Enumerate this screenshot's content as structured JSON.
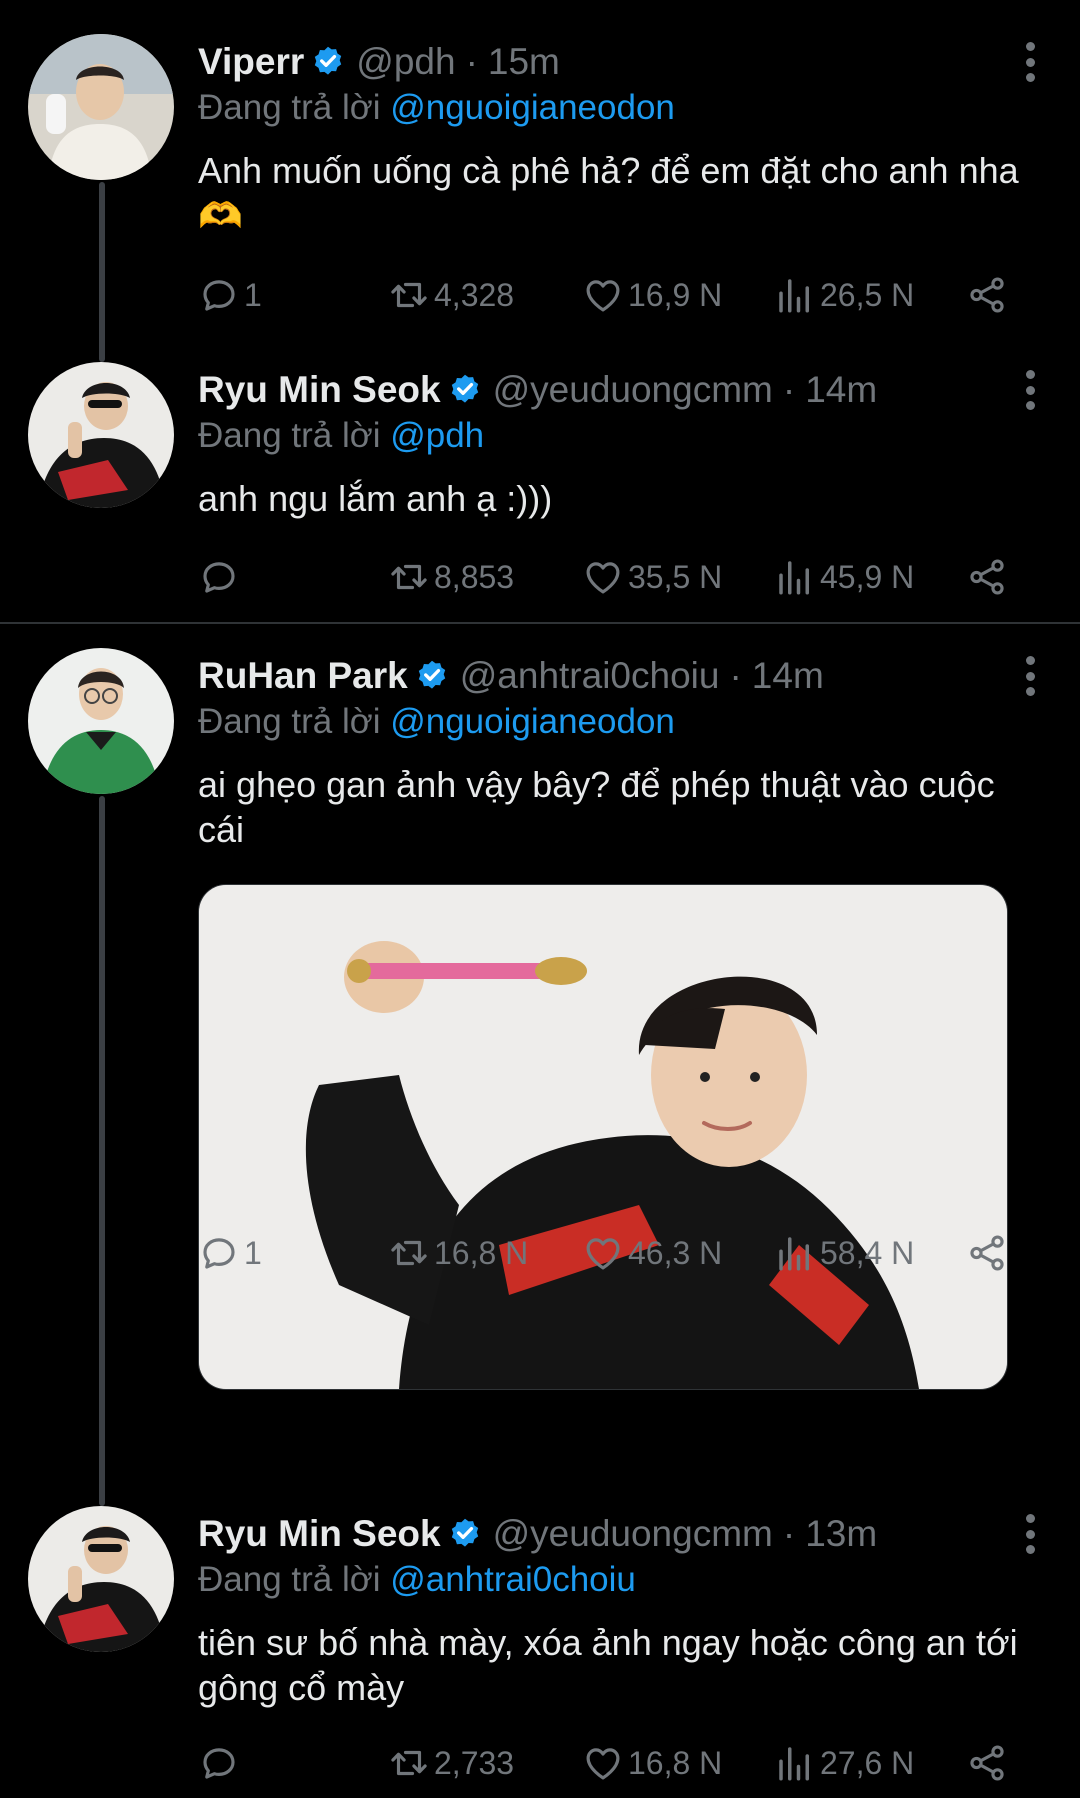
{
  "colors": {
    "background": "#000000",
    "text": "#e7e9ea",
    "muted": "#71767b",
    "accent": "#1d9bf0",
    "verified": "#1d9bf0"
  },
  "icons": {
    "reply": "reply-icon",
    "retweet": "retweet-icon",
    "like": "heart-icon",
    "views": "views-icon",
    "share": "share-icon",
    "more": "more-vertical-icon",
    "verified": "verified-badge-icon"
  },
  "tweets": [
    {
      "name": "Viperr",
      "handle": "@pdh",
      "separator": "·",
      "time": "15m",
      "reply_prefix": "Đang trả lời",
      "reply_to": "@nguoigianeodon",
      "text": "Anh muốn uống cà phê hả? để em đặt cho anh nha 🫶",
      "replies": "1",
      "retweets": "4,328",
      "likes": "16,9 N",
      "views": "26,5 N"
    },
    {
      "name": "Ryu Min Seok",
      "handle": "@yeuduongcmm",
      "separator": "·",
      "time": "14m",
      "reply_prefix": "Đang trả lời",
      "reply_to": "@pdh",
      "text": "anh ngu lắm anh ạ :)))",
      "replies": "",
      "retweets": "8,853",
      "likes": "35,5 N",
      "views": "45,9 N"
    },
    {
      "name": "RuHan Park",
      "handle": "@anhtrai0choiu",
      "separator": "·",
      "time": "14m",
      "reply_prefix": "Đang trả lời",
      "reply_to": "@nguoigianeodon",
      "text": "ai ghẹo gan ảnh vậy bây? để phép thuật vào cuộc cái",
      "replies": "1",
      "retweets": "16,8 N",
      "likes": "46,3 N",
      "views": "58,4 N"
    },
    {
      "name": "Ryu Min Seok",
      "handle": "@yeuduongcmm",
      "separator": "·",
      "time": "13m",
      "reply_prefix": "Đang trả lời",
      "reply_to": "@anhtrai0choiu",
      "text": "tiên sư bố nhà mày, xóa ảnh ngay hoặc công an tới gông cổ mày",
      "replies": "",
      "retweets": "2,733",
      "likes": "16,8 N",
      "views": "27,6 N"
    }
  ]
}
